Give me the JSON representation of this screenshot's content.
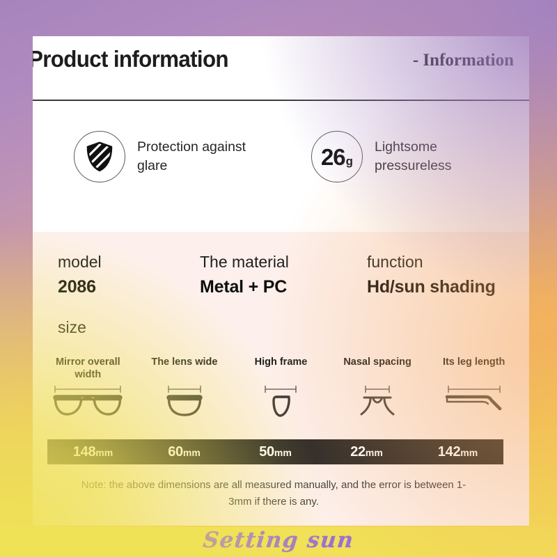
{
  "header": {
    "title": "Product information",
    "subtitle": "- Information"
  },
  "features": [
    {
      "icon": "shield-icon",
      "text": "Protection against glare"
    },
    {
      "icon": "weight-badge",
      "value": "26",
      "unit": "g",
      "text": "Lightsome pressureless"
    }
  ],
  "specs": [
    {
      "key": "model",
      "value": "2086"
    },
    {
      "key": "The material",
      "value": "Metal + PC"
    },
    {
      "key": "function",
      "value": "Hd/sun shading"
    }
  ],
  "size": {
    "heading": "size",
    "columns": [
      {
        "label": "Mirror overall width",
        "icon": "full-frame-icon",
        "number": "148",
        "unit": "mm"
      },
      {
        "label": "The lens wide",
        "icon": "single-lens-icon",
        "number": "60",
        "unit": "mm"
      },
      {
        "label": "High frame",
        "icon": "lens-height-icon",
        "number": "50",
        "unit": "mm"
      },
      {
        "label": "Nasal spacing",
        "icon": "bridge-icon",
        "number": "22",
        "unit": "mm"
      },
      {
        "label": "Its leg length",
        "icon": "temple-arm-icon",
        "number": "142",
        "unit": "mm"
      }
    ],
    "note": "Note: the above dimensions are all measured manually, and the error is between 1-3mm if there is any."
  },
  "watermark": {
    "text": "Setting sun"
  },
  "colors": {
    "card": "#ffffff",
    "panel": "#fdf0ec",
    "measure_bar": "#2c2928",
    "watermark_band": "#f1e157",
    "watermark_text": "#9b6fd4"
  }
}
